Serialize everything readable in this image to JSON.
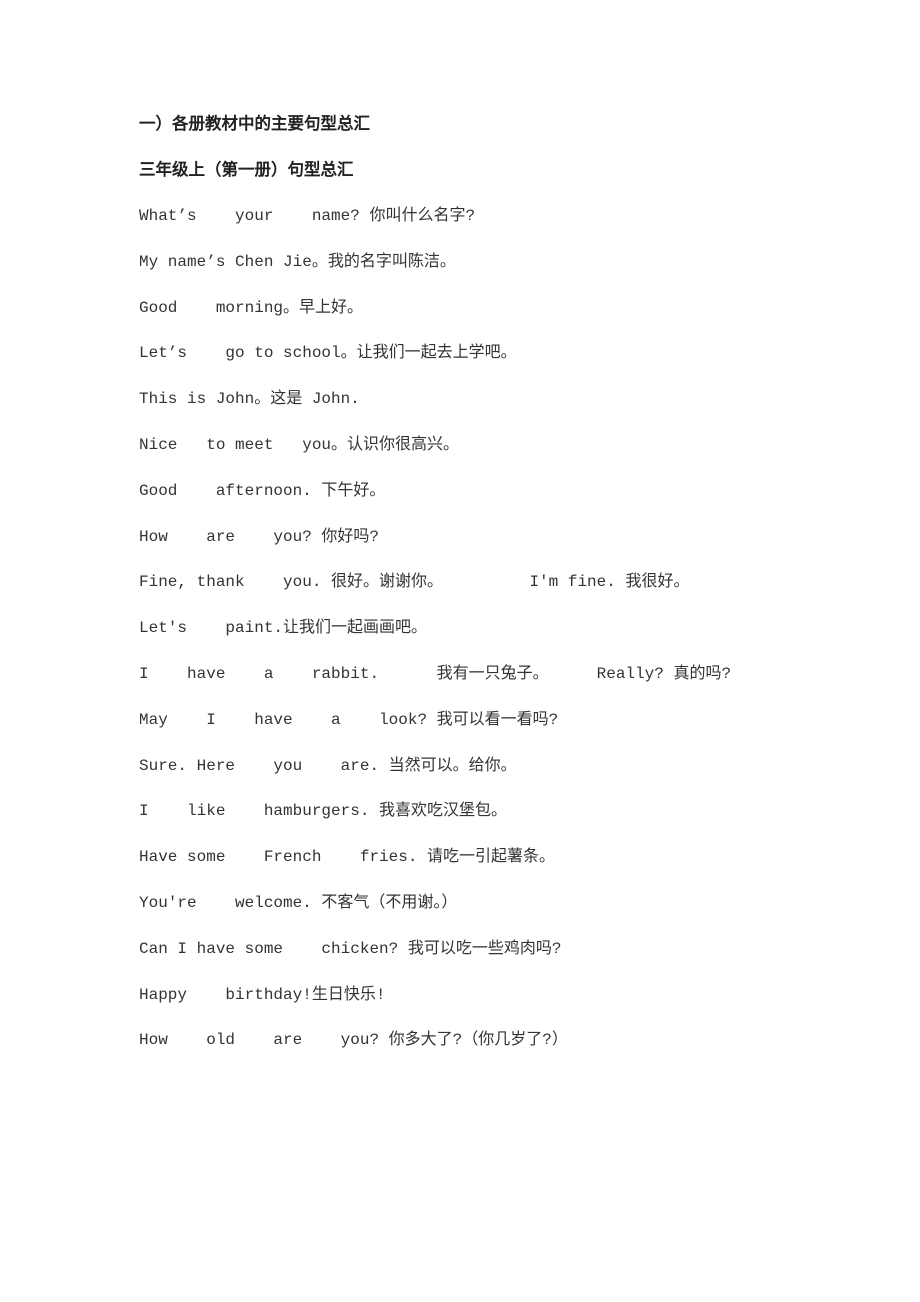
{
  "document": {
    "section_title": "一）各册教材中的主要句型总汇",
    "subsection_title": "三年级上（第一册）句型总汇",
    "lines": [
      "What’s    your    name? 你叫什么名字?",
      "My name’s Chen Jie。我的名字叫陈洁。",
      "Good    morning。早上好。",
      "Let’s    go to school。让我们一起去上学吧。",
      "This is John。这是 John.",
      "Nice   to meet   you。认识你很高兴。",
      "Good    afternoon. 下午好。",
      "How    are    you? 你好吗?",
      "Fine, thank    you. 很好。谢谢你。         I'm fine. 我很好。",
      "Let's    paint.让我们一起画画吧。",
      "I    have    a    rabbit.      我有一只兔子。     Really? 真的吗?",
      "May    I    have    a    look? 我可以看一看吗?",
      "Sure. Here    you    are. 当然可以。给你。",
      "I    like    hamburgers. 我喜欢吃汉堡包。",
      "Have some    French    fries. 请吃一引起薯条。",
      "You're    welcome. 不客气（不用谢。）",
      "Can I have some    chicken? 我可以吃一些鸡肉吗?",
      "Happy    birthday!生日快乐!",
      "How    old    are    you? 你多大了?（你几岁了?）"
    ]
  }
}
